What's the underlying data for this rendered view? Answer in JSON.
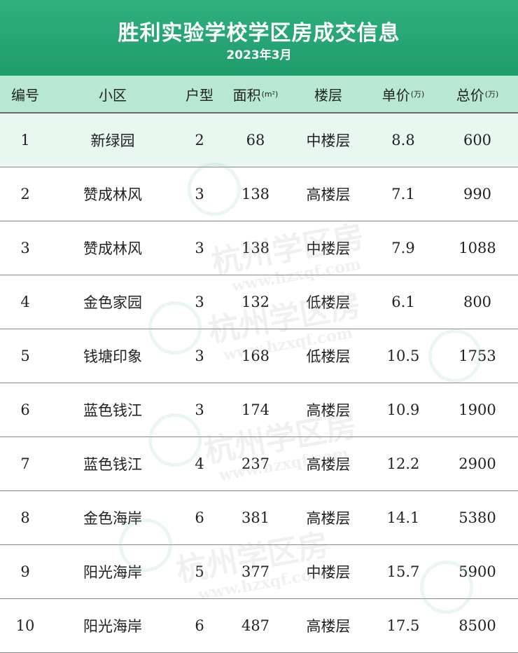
{
  "title": "胜利实验学校学区房成交信息",
  "subtitle": "2023年3月",
  "watermark": {
    "brand": "杭州学区房",
    "url": "www.hzxqf.com"
  },
  "table": {
    "headers": [
      {
        "label": "编号",
        "unit": ""
      },
      {
        "label": "小区",
        "unit": ""
      },
      {
        "label": "户型",
        "unit": ""
      },
      {
        "label": "面积",
        "unit": "(m²)"
      },
      {
        "label": "楼层",
        "unit": ""
      },
      {
        "label": "单价",
        "unit": "(万)"
      },
      {
        "label": "总价",
        "unit": "(万)"
      }
    ],
    "rows": [
      [
        "1",
        "新绿园",
        "2",
        "68",
        "中楼层",
        "8.8",
        "600"
      ],
      [
        "2",
        "赞成林风",
        "3",
        "138",
        "高楼层",
        "7.1",
        "990"
      ],
      [
        "3",
        "赞成林风",
        "3",
        "138",
        "中楼层",
        "7.9",
        "1088"
      ],
      [
        "4",
        "金色家园",
        "3",
        "132",
        "低楼层",
        "6.1",
        "800"
      ],
      [
        "5",
        "钱塘印象",
        "3",
        "168",
        "低楼层",
        "10.5",
        "1753"
      ],
      [
        "6",
        "蓝色钱江",
        "3",
        "174",
        "高楼层",
        "10.9",
        "1900"
      ],
      [
        "7",
        "蓝色钱江",
        "4",
        "237",
        "高楼层",
        "12.2",
        "2900"
      ],
      [
        "8",
        "金色海岸",
        "6",
        "381",
        "高楼层",
        "14.1",
        "5380"
      ],
      [
        "9",
        "阳光海岸",
        "5",
        "377",
        "中楼层",
        "15.7",
        "5900"
      ],
      [
        "10",
        "阳光海岸",
        "6",
        "487",
        "高楼层",
        "17.5",
        "8500"
      ]
    ]
  },
  "colors": {
    "title_bg": "#1f9c6b",
    "header_bg": "#b8e8d4",
    "alt_row_bg": "#e9f7f1",
    "text": "#222222"
  }
}
